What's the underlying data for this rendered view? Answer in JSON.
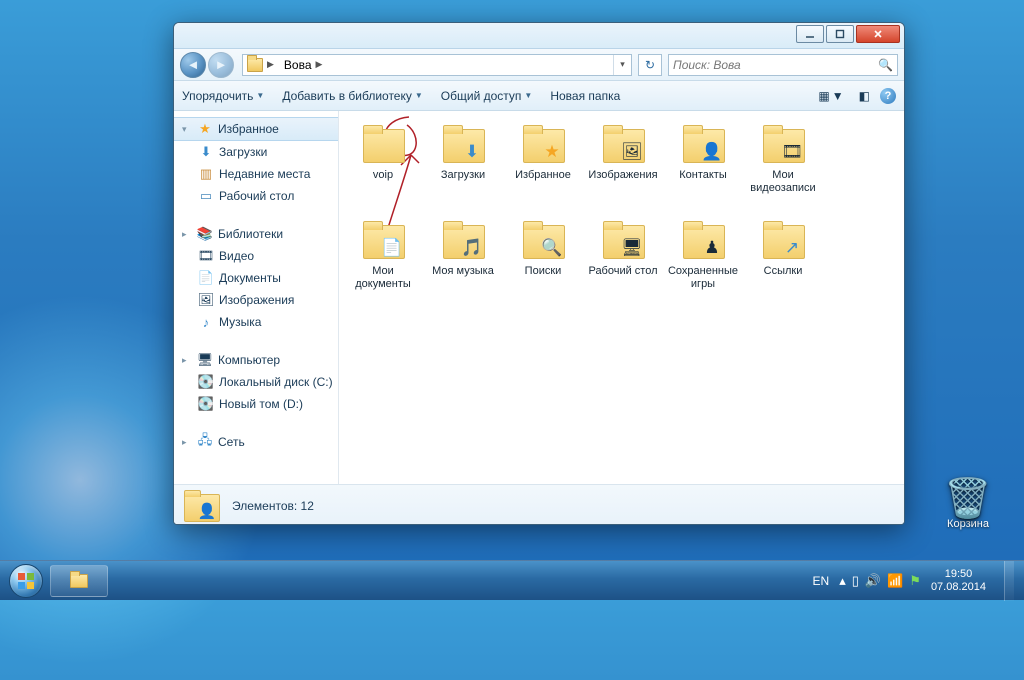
{
  "breadcrumb": {
    "root_icon": "user-folder",
    "current": "Вова"
  },
  "search": {
    "placeholder": "Поиск: Вова"
  },
  "toolbar": {
    "organize": "Упорядочить",
    "addlib": "Добавить в библиотеку",
    "share": "Общий доступ",
    "newfolder": "Новая папка"
  },
  "sidebar": {
    "favorites": {
      "label": "Избранное",
      "items": [
        {
          "icon": "download",
          "label": "Загрузки"
        },
        {
          "icon": "recent",
          "label": "Недавние места"
        },
        {
          "icon": "desktop",
          "label": "Рабочий стол"
        }
      ]
    },
    "libraries": {
      "label": "Библиотеки",
      "items": [
        {
          "icon": "video",
          "label": "Видео"
        },
        {
          "icon": "document",
          "label": "Документы"
        },
        {
          "icon": "image",
          "label": "Изображения"
        },
        {
          "icon": "music",
          "label": "Музыка"
        }
      ]
    },
    "computer": {
      "label": "Компьютер",
      "items": [
        {
          "icon": "drive-c",
          "label": "Локальный диск (C:)"
        },
        {
          "icon": "drive-d",
          "label": "Новый том (D:)"
        }
      ]
    },
    "network": {
      "label": "Сеть"
    }
  },
  "folders": [
    {
      "name": "voip",
      "overlay": ""
    },
    {
      "name": "Загрузки",
      "overlay": "⬇"
    },
    {
      "name": "Избранное",
      "overlay": "★"
    },
    {
      "name": "Изображения",
      "overlay": "🖼"
    },
    {
      "name": "Контакты",
      "overlay": "👤"
    },
    {
      "name": "Мои видеозаписи",
      "overlay": "🎞"
    },
    {
      "name": "Мои документы",
      "overlay": "📄"
    },
    {
      "name": "Моя музыка",
      "overlay": "🎵"
    },
    {
      "name": "Поиски",
      "overlay": "🔍"
    },
    {
      "name": "Рабочий стол",
      "overlay": "🖥"
    },
    {
      "name": "Сохраненные игры",
      "overlay": "♟"
    },
    {
      "name": "Ссылки",
      "overlay": "↗"
    }
  ],
  "details": {
    "count_label": "Элементов: 12"
  },
  "desktop": {
    "recycle": "Корзина"
  },
  "tray": {
    "lang": "EN",
    "time": "19:50",
    "date": "07.08.2014"
  }
}
